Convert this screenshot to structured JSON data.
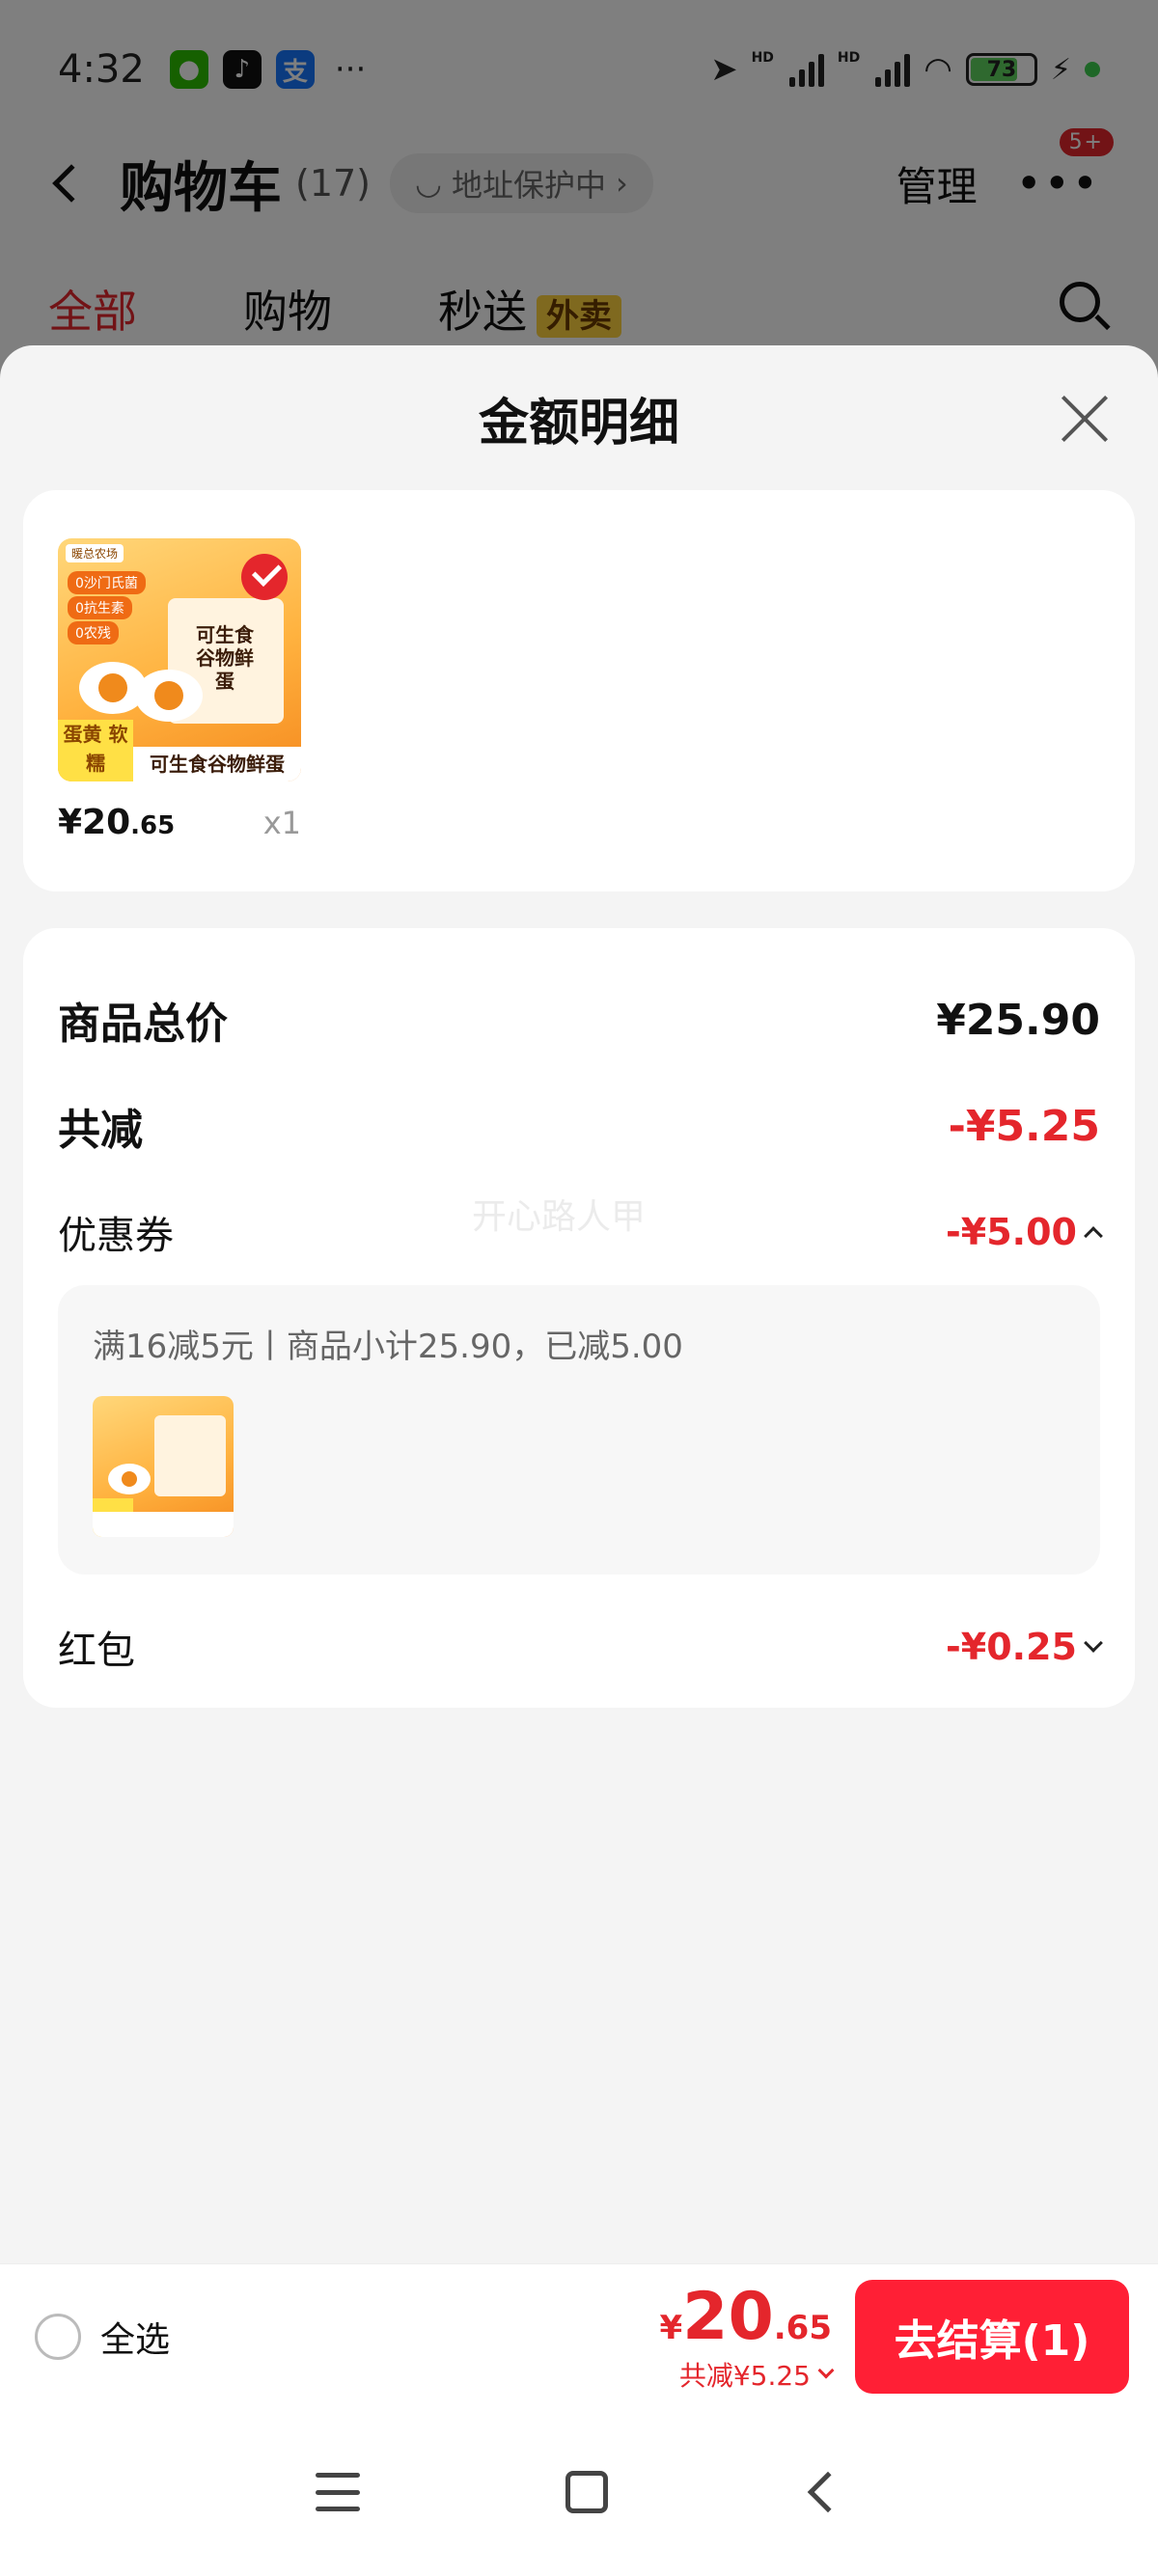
{
  "status_bar": {
    "time": "4:32",
    "more": "···",
    "battery": "73",
    "hd1": "HD",
    "hd2": "HD",
    "apps": [
      "wechat-icon",
      "tiktok-icon",
      "alipay-icon"
    ],
    "alipay_glyph": "支"
  },
  "nav": {
    "title": "购物车",
    "count": "(17)",
    "address_pill": "地址保护中",
    "manage": "管理",
    "badge": "5+"
  },
  "tabs": [
    {
      "label": "全部",
      "active": true
    },
    {
      "label": "购物",
      "active": false
    },
    {
      "label": "秒送",
      "active": false,
      "tag": "外卖"
    }
  ],
  "sheet": {
    "title": "金额明细",
    "product": {
      "price_int": "¥20",
      "price_dec": ".65",
      "qty": "x1",
      "image_text": {
        "brand": "暖总农场",
        "tags": [
          "0沙门氏菌",
          "0抗生素",
          "0农残"
        ],
        "box": "可生食 谷物鲜蛋",
        "side": "蛋黄 软糯",
        "bottom": "可生食谷物鲜蛋"
      }
    },
    "summary": {
      "total_label": "商品总价",
      "total_value": "¥25.90",
      "discount_label": "共减",
      "discount_value": "-¥5.25",
      "coupon_label": "优惠券",
      "coupon_value": "-¥5.00",
      "coupon_detail": "满16减5元丨商品小计25.90，已减5.00",
      "redpacket_label": "红包",
      "redpacket_value": "-¥0.25"
    },
    "watermark": "开心路人甲"
  },
  "checkout": {
    "select_all": "全选",
    "currency": "¥",
    "total_int": "20",
    "total_dec": ".65",
    "discount": "共减¥5.25",
    "button": "去结算(1)"
  },
  "colors": {
    "accent": "#e4262c",
    "button": "#ff1f35",
    "waimai_tag": "#ffd23f"
  }
}
